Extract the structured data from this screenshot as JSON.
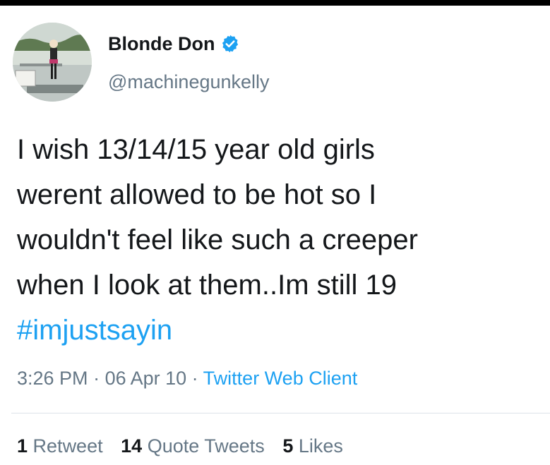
{
  "user": {
    "display_name": "Blonde Don",
    "handle": "@machinegunkelly",
    "verified": true,
    "avatar_icon": "profile-photo"
  },
  "tweet": {
    "text_lines": [
      "I wish 13/14/15 year old girls",
      "werent allowed to be hot so I",
      "wouldn't feel like such a creeper",
      "when I look at them..Im still 19"
    ],
    "hashtag": "#imjustsayin",
    "time": "3:26 PM",
    "separator": " · ",
    "date": "06 Apr 10",
    "source": "Twitter Web Client"
  },
  "stats": {
    "retweets": {
      "count": "1",
      "label": "Retweet"
    },
    "quote_tweets": {
      "count": "14",
      "label": "Quote Tweets"
    },
    "likes": {
      "count": "5",
      "label": "Likes"
    }
  },
  "colors": {
    "link": "#1da1f2",
    "secondary_text": "#657786",
    "primary_text": "#14171a"
  }
}
